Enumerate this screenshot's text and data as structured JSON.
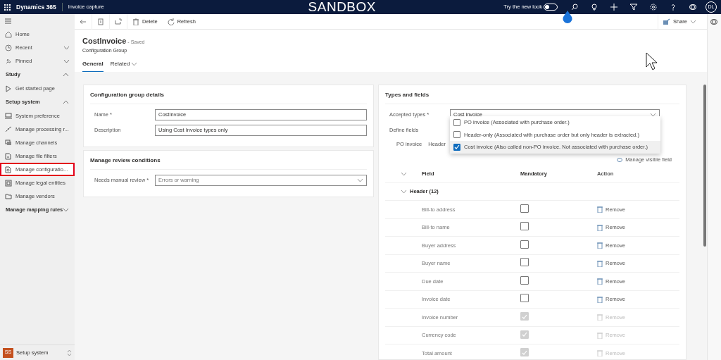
{
  "topbar": {
    "app": "Dynamics 365",
    "module": "Invoice capture",
    "environment": "SANDBOX",
    "toggle": {
      "label": "Try the new look",
      "on": false
    },
    "avatar": "DL"
  },
  "sidebar": {
    "top": [
      {
        "label": "Home"
      },
      {
        "label": "Recent",
        "expanded": false
      },
      {
        "label": "Pinned",
        "expanded": false
      }
    ],
    "groups": [
      {
        "label": "Study",
        "expanded": true,
        "items": [
          {
            "label": "Get started page",
            "selected": false,
            "highlighted": false
          }
        ]
      },
      {
        "label": "Setup system",
        "expanded": true,
        "items": [
          {
            "label": "System preference",
            "selected": false,
            "highlighted": false
          },
          {
            "label": "Manage processing r...",
            "selected": false,
            "highlighted": false
          },
          {
            "label": "Manage channels",
            "selected": false,
            "highlighted": false
          },
          {
            "label": "Manage file filters",
            "selected": false,
            "highlighted": false
          },
          {
            "label": "Manage configuratio...",
            "selected": true,
            "highlighted": true
          },
          {
            "label": "Manage legal entities",
            "selected": false,
            "highlighted": false
          },
          {
            "label": "Manage vendors",
            "selected": false,
            "highlighted": false
          }
        ]
      },
      {
        "label": "Manage mapping rules",
        "expanded": false
      }
    ],
    "area": {
      "badge": "SS",
      "label": "Setup system"
    }
  },
  "command_bar": {
    "buttons": [
      "Delete",
      "Refresh"
    ],
    "share": "Share"
  },
  "record": {
    "title": "CostInvoice",
    "status": "- Saved",
    "entity": "Configuration Group",
    "tabs": [
      {
        "label": "General",
        "selected": true
      },
      {
        "label": "Related",
        "selected": false
      }
    ]
  },
  "details": {
    "title": "Configuration group details",
    "fields": [
      {
        "label": "Name *",
        "value": "CostInvoice"
      },
      {
        "label": "Description",
        "value": "Using Cost Invoice types only"
      }
    ]
  },
  "review": {
    "title": "Manage review conditions",
    "label": "Needs manual review *",
    "value": "Errors or warning"
  },
  "types": {
    "title": "Types and fields",
    "label": "Accepted types *",
    "value": "Cost invoice",
    "options": [
      {
        "label": "PO invoice (Associated with purchase order.)",
        "checked": false,
        "selected": false
      },
      {
        "label": "Header-only (Associated with purchase order but only header is extracted.)",
        "checked": false,
        "selected": false
      },
      {
        "label": "Cost invoice (Also called non-PO invoice. Not associated with purchase order.)",
        "checked": true,
        "selected": true
      }
    ],
    "define_label": "Define fields",
    "field_tabs": [
      "PO invoice",
      "Header"
    ],
    "manage_link": "Manage visible field",
    "columns": [
      "Field",
      "Mandatory",
      "Action"
    ],
    "group": {
      "label": "Header (12)",
      "expanded": true
    },
    "rows": [
      {
        "field": "Bill-to address",
        "mandatory": false,
        "disabled": false,
        "action": "Remove"
      },
      {
        "field": "Bill-to name",
        "mandatory": false,
        "disabled": false,
        "action": "Remove"
      },
      {
        "field": "Buyer address",
        "mandatory": false,
        "disabled": false,
        "action": "Remove"
      },
      {
        "field": "Buyer name",
        "mandatory": false,
        "disabled": false,
        "action": "Remove"
      },
      {
        "field": "Due date",
        "mandatory": false,
        "disabled": false,
        "action": "Remove"
      },
      {
        "field": "Invoice date",
        "mandatory": false,
        "disabled": false,
        "action": "Remove"
      },
      {
        "field": "Invoice number",
        "mandatory": true,
        "disabled": true,
        "action": "Remove"
      },
      {
        "field": "Currency code",
        "mandatory": true,
        "disabled": true,
        "action": "Remove"
      },
      {
        "field": "Total amount",
        "mandatory": true,
        "disabled": true,
        "action": "Remove"
      }
    ]
  }
}
